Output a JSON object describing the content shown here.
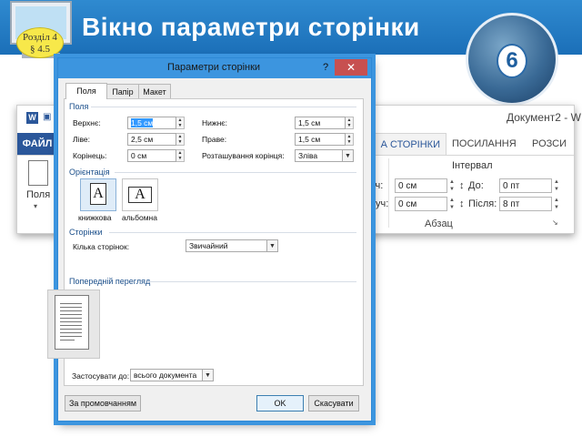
{
  "slide": {
    "title": "Вікно параметри сторінки",
    "badge_line1": "Розділ 4",
    "badge_line2": "§ 4.5",
    "logo_number": "6",
    "header_color": "#1f73bd"
  },
  "ribbon": {
    "doc_title": "Документ2 - W",
    "word_icon": "W",
    "tabs": {
      "file": "ФАЙЛ",
      "layout": "А СТОРІНКИ",
      "references": "ПОСИЛАННЯ",
      "mailings": "РОЗСИ"
    },
    "margins_label": "Поля",
    "spacing": {
      "title": "Інтервал",
      "left_label": "уч:",
      "left_value": "0 см",
      "right_label": "руч:",
      "right_value": "0 см",
      "before_label": "До:",
      "before_value": "0 пт",
      "after_label": "Після:",
      "after_value": "8 пт"
    },
    "group_label": "Абзац"
  },
  "dialog": {
    "title": "Параметри сторінки",
    "help": "?",
    "close": "✕",
    "tabs": [
      "Поля",
      "Папір",
      "Макет"
    ],
    "margins_section": "Поля",
    "fields": {
      "top_label": "Верхнє:",
      "top_value": "1,5 см",
      "bottom_label": "Нижнє:",
      "bottom_value": "1,5 см",
      "left_label": "Ліве:",
      "left_value": "2,5 см",
      "right_label": "Праве:",
      "right_value": "1,5 см",
      "gutter_label": "Корінець:",
      "gutter_value": "0 см",
      "gutter_pos_label": "Розташування корінця:",
      "gutter_pos_value": "Зліва"
    },
    "orientation_section": "Орієнтація",
    "portrait_label": "книжкова",
    "landscape_label": "альбомна",
    "orientation_glyph": "A",
    "pages_section": "Сторінки",
    "multiple_pages_label": "Кілька сторінок:",
    "multiple_pages_value": "Звичайний",
    "preview_section": "Попередній перегляд",
    "apply_to_label": "Застосувати до:",
    "apply_to_value": "всього документа",
    "default_button": "За промовчанням",
    "ok_button": "OK",
    "cancel_button": "Скасувати",
    "accent_color": "#3c95df"
  }
}
